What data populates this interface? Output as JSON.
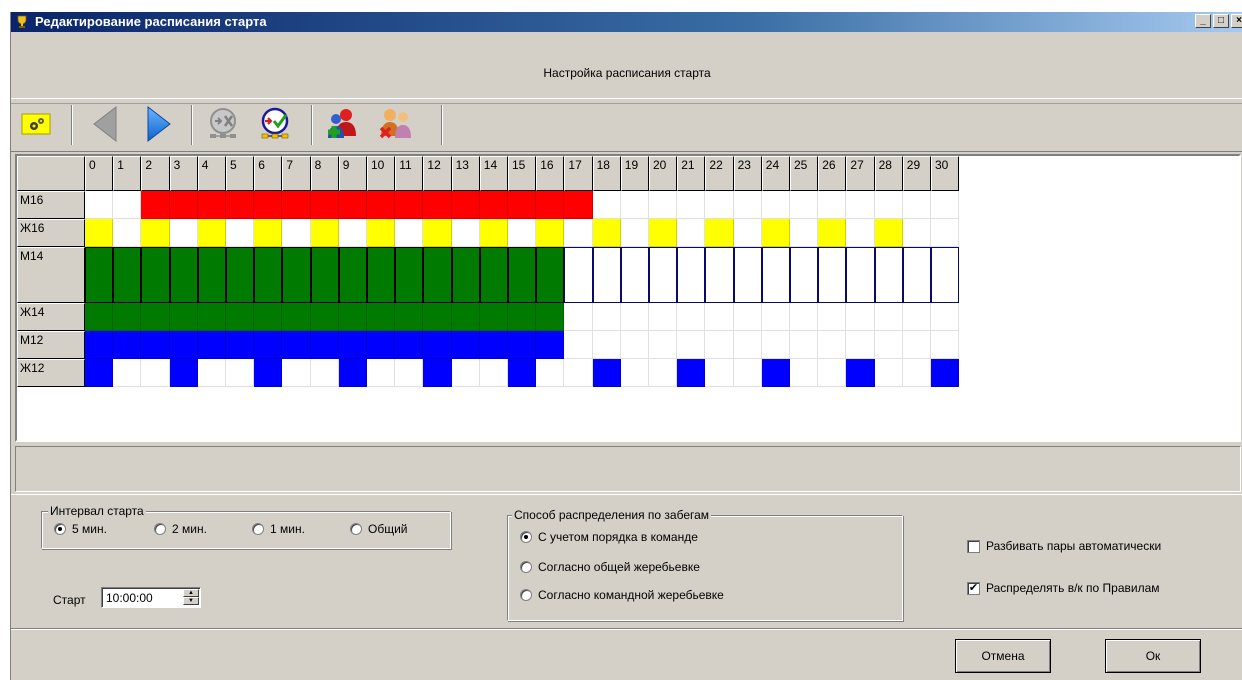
{
  "window": {
    "title": "Редактирование расписания старта",
    "controls": [
      "_",
      "□",
      "×"
    ]
  },
  "header": {
    "caption": "Настройка расписания старта"
  },
  "toolbar": {
    "icons": [
      "settings-icon",
      "prev-arrow-icon",
      "next-arrow-icon",
      "clear-schedule-icon",
      "check-schedule-icon",
      "add-group-icon",
      "remove-group-icon"
    ]
  },
  "grid": {
    "columns": [
      "0",
      "1",
      "2",
      "3",
      "4",
      "5",
      "6",
      "7",
      "8",
      "9",
      "10",
      "11",
      "12",
      "13",
      "14",
      "15",
      "16",
      "17",
      "18",
      "19",
      "20",
      "21",
      "22",
      "23",
      "24",
      "25",
      "26",
      "27",
      "28",
      "29",
      "30"
    ],
    "rows": [
      {
        "label": "М16",
        "tall": false,
        "color": "#ff0000",
        "filled": [
          2,
          3,
          4,
          5,
          6,
          7,
          8,
          9,
          10,
          11,
          12,
          13,
          14,
          15,
          16,
          17
        ],
        "outlined": []
      },
      {
        "label": "Ж16",
        "tall": false,
        "color": "#ffff00",
        "filled": [
          0,
          2,
          4,
          6,
          8,
          10,
          12,
          14,
          16,
          18,
          20,
          22,
          24,
          26,
          28
        ],
        "outlined": []
      },
      {
        "label": "М14",
        "tall": true,
        "color": "#007a00",
        "filled": [
          0,
          1,
          2,
          3,
          4,
          5,
          6,
          7,
          8,
          9,
          10,
          11,
          12,
          13,
          14,
          15,
          16
        ],
        "outlined": [
          17,
          18,
          19,
          20,
          21,
          22,
          23,
          24,
          25,
          26,
          27,
          28,
          29,
          30
        ]
      },
      {
        "label": "Ж14",
        "tall": false,
        "color": "#007a00",
        "filled": [
          0,
          1,
          2,
          3,
          4,
          5,
          6,
          7,
          8,
          9,
          10,
          11,
          12,
          13,
          14,
          15,
          16
        ],
        "outlined": []
      },
      {
        "label": "М12",
        "tall": false,
        "color": "#0000ff",
        "filled": [
          0,
          1,
          2,
          3,
          4,
          5,
          6,
          7,
          8,
          9,
          10,
          11,
          12,
          13,
          14,
          15,
          16
        ],
        "outlined": []
      },
      {
        "label": "Ж12",
        "tall": false,
        "color": "#0000ff",
        "filled": [
          0,
          3,
          6,
          9,
          12,
          15,
          18,
          21,
          24,
          27,
          30
        ],
        "outlined": []
      }
    ]
  },
  "interval": {
    "legend": "Интервал старта",
    "options": [
      "5 мин.",
      "2 мин.",
      "1 мин.",
      "Общий"
    ],
    "selected": 0
  },
  "start": {
    "label": "Старт",
    "value": "10:00:00"
  },
  "distribution": {
    "legend": "Способ распределения по забегам",
    "options": [
      "С учетом порядка в команде",
      "Согласно общей жеребьевке",
      "Согласно командной жеребьевке"
    ],
    "selected": 0
  },
  "checkboxes": [
    {
      "label": "Разбивать пары автоматически",
      "checked": false
    },
    {
      "label": "Распределять в/к  по Правилам",
      "checked": true
    }
  ],
  "buttons": {
    "cancel": "Отмена",
    "ok": "Ок"
  }
}
